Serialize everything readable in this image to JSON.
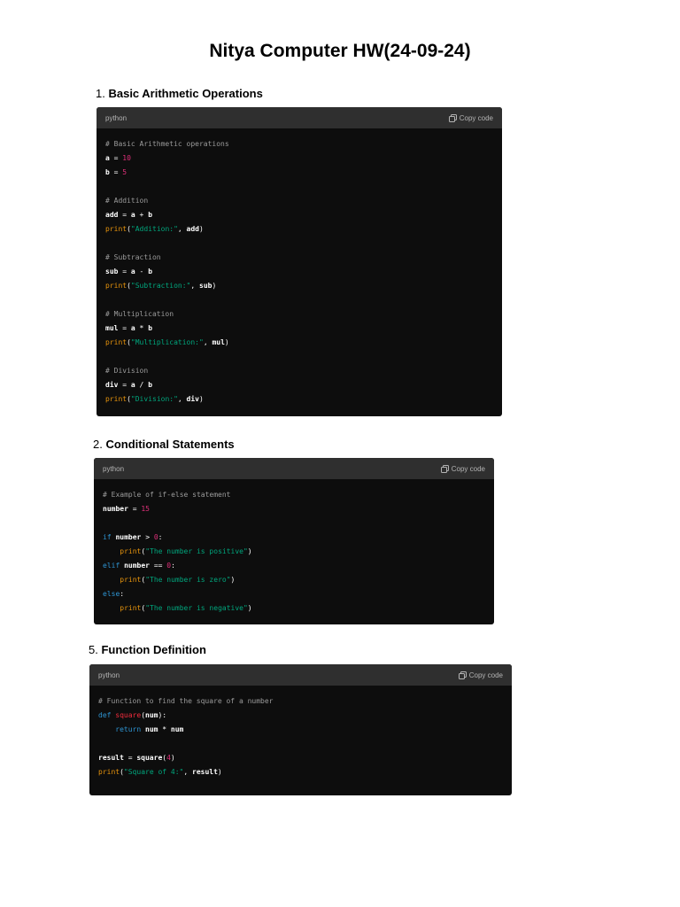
{
  "document": {
    "title": "Nitya Computer HW(24-09-24)"
  },
  "sections": [
    {
      "number": "1.",
      "heading": "Basic Arithmetic Operations",
      "language": "python",
      "copy_label": "Copy code",
      "lines": [
        [
          {
            "t": "# Basic Arithmetic operations",
            "c": "comment"
          }
        ],
        [
          {
            "t": "a",
            "c": "ident"
          },
          {
            "t": " = ",
            "c": "op"
          },
          {
            "t": "10",
            "c": "num"
          }
        ],
        [
          {
            "t": "b",
            "c": "ident"
          },
          {
            "t": " = ",
            "c": "op"
          },
          {
            "t": "5",
            "c": "num"
          }
        ],
        [],
        [
          {
            "t": "# Addition",
            "c": "comment"
          }
        ],
        [
          {
            "t": "add",
            "c": "ident"
          },
          {
            "t": " = ",
            "c": "op"
          },
          {
            "t": "a",
            "c": "ident"
          },
          {
            "t": " + ",
            "c": "op"
          },
          {
            "t": "b",
            "c": "ident"
          }
        ],
        [
          {
            "t": "print",
            "c": "func"
          },
          {
            "t": "(",
            "c": "op"
          },
          {
            "t": "\"Addition:\"",
            "c": "str"
          },
          {
            "t": ", ",
            "c": "op"
          },
          {
            "t": "add",
            "c": "ident"
          },
          {
            "t": ")",
            "c": "op"
          }
        ],
        [],
        [
          {
            "t": "# Subtraction",
            "c": "comment"
          }
        ],
        [
          {
            "t": "sub",
            "c": "ident"
          },
          {
            "t": " = ",
            "c": "op"
          },
          {
            "t": "a",
            "c": "ident"
          },
          {
            "t": " - ",
            "c": "op"
          },
          {
            "t": "b",
            "c": "ident"
          }
        ],
        [
          {
            "t": "print",
            "c": "func"
          },
          {
            "t": "(",
            "c": "op"
          },
          {
            "t": "\"Subtraction:\"",
            "c": "str"
          },
          {
            "t": ", ",
            "c": "op"
          },
          {
            "t": "sub",
            "c": "ident"
          },
          {
            "t": ")",
            "c": "op"
          }
        ],
        [],
        [
          {
            "t": "# Multiplication",
            "c": "comment"
          }
        ],
        [
          {
            "t": "mul",
            "c": "ident"
          },
          {
            "t": " = ",
            "c": "op"
          },
          {
            "t": "a",
            "c": "ident"
          },
          {
            "t": " * ",
            "c": "op"
          },
          {
            "t": "b",
            "c": "ident"
          }
        ],
        [
          {
            "t": "print",
            "c": "func"
          },
          {
            "t": "(",
            "c": "op"
          },
          {
            "t": "\"Multiplication:\"",
            "c": "str"
          },
          {
            "t": ", ",
            "c": "op"
          },
          {
            "t": "mul",
            "c": "ident"
          },
          {
            "t": ")",
            "c": "op"
          }
        ],
        [],
        [
          {
            "t": "# Division",
            "c": "comment"
          }
        ],
        [
          {
            "t": "div",
            "c": "ident"
          },
          {
            "t": " = ",
            "c": "op"
          },
          {
            "t": "a",
            "c": "ident"
          },
          {
            "t": " / ",
            "c": "op"
          },
          {
            "t": "b",
            "c": "ident"
          }
        ],
        [
          {
            "t": "print",
            "c": "func"
          },
          {
            "t": "(",
            "c": "op"
          },
          {
            "t": "\"Division:\"",
            "c": "str"
          },
          {
            "t": ", ",
            "c": "op"
          },
          {
            "t": "div",
            "c": "ident"
          },
          {
            "t": ")",
            "c": "op"
          }
        ]
      ]
    },
    {
      "number": "2.",
      "heading": "Conditional Statements",
      "language": "python",
      "copy_label": "Copy code",
      "lines": [
        [
          {
            "t": "# Example of if-else statement",
            "c": "comment"
          }
        ],
        [
          {
            "t": "number",
            "c": "ident"
          },
          {
            "t": " = ",
            "c": "op"
          },
          {
            "t": "15",
            "c": "num"
          }
        ],
        [],
        [
          {
            "t": "if",
            "c": "kw"
          },
          {
            "t": " ",
            "c": "op"
          },
          {
            "t": "number",
            "c": "ident"
          },
          {
            "t": " > ",
            "c": "op"
          },
          {
            "t": "0",
            "c": "num"
          },
          {
            "t": ":",
            "c": "op"
          }
        ],
        [
          {
            "t": "    ",
            "c": "op"
          },
          {
            "t": "print",
            "c": "func"
          },
          {
            "t": "(",
            "c": "op"
          },
          {
            "t": "\"The number is positive\"",
            "c": "str"
          },
          {
            "t": ")",
            "c": "op"
          }
        ],
        [
          {
            "t": "elif",
            "c": "kw"
          },
          {
            "t": " ",
            "c": "op"
          },
          {
            "t": "number",
            "c": "ident"
          },
          {
            "t": " == ",
            "c": "op"
          },
          {
            "t": "0",
            "c": "num"
          },
          {
            "t": ":",
            "c": "op"
          }
        ],
        [
          {
            "t": "    ",
            "c": "op"
          },
          {
            "t": "print",
            "c": "func"
          },
          {
            "t": "(",
            "c": "op"
          },
          {
            "t": "\"The number is zero\"",
            "c": "str"
          },
          {
            "t": ")",
            "c": "op"
          }
        ],
        [
          {
            "t": "else",
            "c": "kw"
          },
          {
            "t": ":",
            "c": "op"
          }
        ],
        [
          {
            "t": "    ",
            "c": "op"
          },
          {
            "t": "print",
            "c": "func"
          },
          {
            "t": "(",
            "c": "op"
          },
          {
            "t": "\"The number is negative\"",
            "c": "str"
          },
          {
            "t": ")",
            "c": "op"
          }
        ]
      ]
    },
    {
      "number": "5.",
      "heading": "Function Definition",
      "language": "python",
      "copy_label": "Copy code",
      "lines": [
        [
          {
            "t": "# Function to find the square of a number",
            "c": "comment"
          }
        ],
        [
          {
            "t": "def",
            "c": "kw"
          },
          {
            "t": " ",
            "c": "op"
          },
          {
            "t": "square",
            "c": "def"
          },
          {
            "t": "(",
            "c": "op"
          },
          {
            "t": "num",
            "c": "ident"
          },
          {
            "t": "):",
            "c": "op"
          }
        ],
        [
          {
            "t": "    ",
            "c": "op"
          },
          {
            "t": "return",
            "c": "kw"
          },
          {
            "t": " ",
            "c": "op"
          },
          {
            "t": "num",
            "c": "ident"
          },
          {
            "t": " * ",
            "c": "op"
          },
          {
            "t": "num",
            "c": "ident"
          }
        ],
        [],
        [
          {
            "t": "result",
            "c": "ident"
          },
          {
            "t": " = ",
            "c": "op"
          },
          {
            "t": "square",
            "c": "ident"
          },
          {
            "t": "(",
            "c": "op"
          },
          {
            "t": "4",
            "c": "num"
          },
          {
            "t": ")",
            "c": "op"
          }
        ],
        [
          {
            "t": "print",
            "c": "func"
          },
          {
            "t": "(",
            "c": "op"
          },
          {
            "t": "\"Square of 4:\"",
            "c": "str"
          },
          {
            "t": ", ",
            "c": "op"
          },
          {
            "t": "result",
            "c": "ident"
          },
          {
            "t": ")",
            "c": "op"
          }
        ]
      ]
    }
  ],
  "colors": {
    "code_background": "#0d0d0d",
    "header_background": "#2f2f2f",
    "comment": "#9b9b9b",
    "number": "#df3079",
    "builtin_function": "#e9950c",
    "string": "#00a67d",
    "keyword": "#2e95d3",
    "defined_function": "#f22c3d"
  },
  "icons": {
    "copy": "copy-icon"
  }
}
